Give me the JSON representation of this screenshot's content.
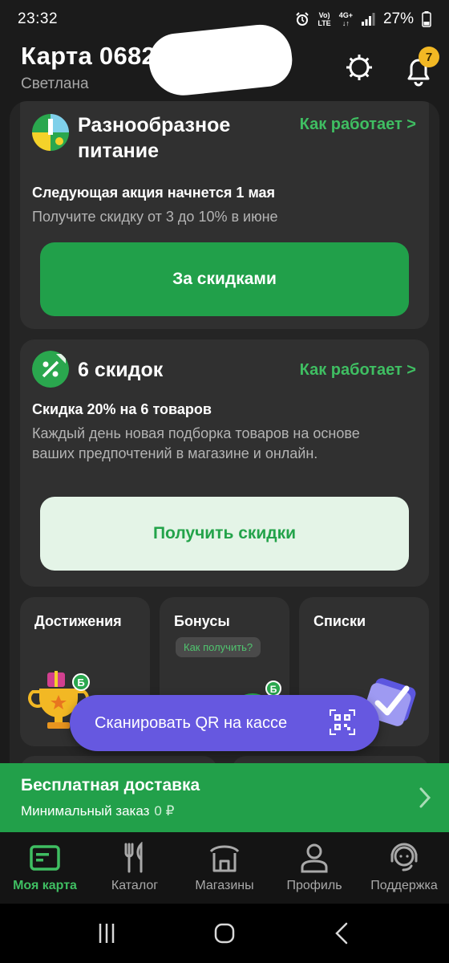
{
  "status_bar": {
    "time": "23:32",
    "network_label_top": "Vo)",
    "network_label_bottom": "LTE",
    "network_type": "4G+",
    "battery": "27%"
  },
  "header": {
    "card_title": "Карта 0682",
    "owner_name": "Светлана",
    "notifications_count": "7"
  },
  "promos": [
    {
      "title": "Разнообразное питание",
      "link": "Как работает >",
      "subtitle": "Следующая акция начнется 1 мая",
      "description": "Получите скидку от 3 до 10% в июне",
      "button": "За скидками"
    },
    {
      "title": "6 скидок",
      "link": "Как работает >",
      "subtitle": "Скидка 20% на 6 товаров",
      "description": "Каждый день новая подборка товаров на основе ваших предпочтений в магазине и онлайн.",
      "button": "Получить скидки"
    }
  ],
  "tiles": [
    {
      "title": "Достижения"
    },
    {
      "title": "Бонусы",
      "chip": "Как получить?"
    },
    {
      "title": "Списки"
    }
  ],
  "scan_button": "Сканировать QR на кассе",
  "delivery": {
    "title": "Бесплатная доставка",
    "subtitle": "Минимальный заказ",
    "value": "0 ₽"
  },
  "bottom_nav": [
    {
      "label": "Моя карта",
      "icon": "card-icon",
      "active": true
    },
    {
      "label": "Каталог",
      "icon": "fork-knife-icon"
    },
    {
      "label": "Магазины",
      "icon": "store-icon"
    },
    {
      "label": "Профиль",
      "icon": "person-icon"
    },
    {
      "label": "Поддержка",
      "icon": "headset-icon"
    }
  ],
  "colors": {
    "accent_green": "#21a04a",
    "link_green": "#3fbe62",
    "scan_purple": "#6658e0",
    "badge_yellow": "#f2b824"
  }
}
